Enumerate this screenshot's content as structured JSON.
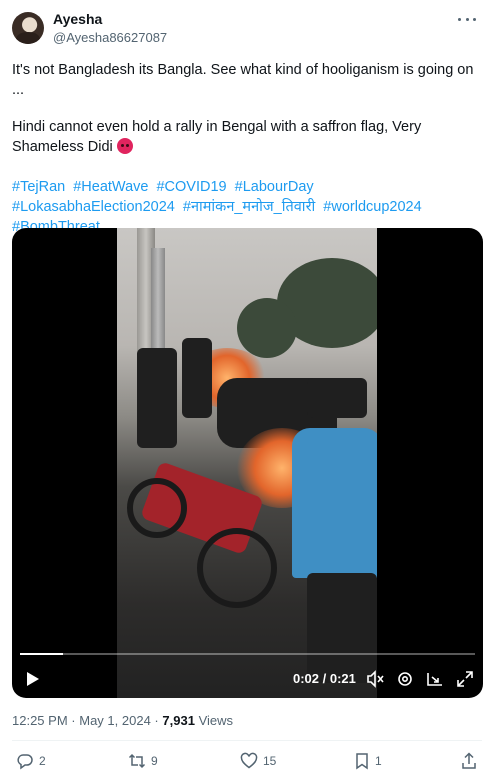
{
  "author": {
    "name": "Ayesha",
    "handle": "@Ayesha86627087"
  },
  "post": {
    "line1": "It's not Bangladesh its Bangla. See what kind of hooliganism is going on ...",
    "line2": "Hindi cannot even hold a rally in Bengal with a saffron flag, Very Shameless Didi",
    "emoji_icon": "angry-face-icon",
    "hashtags": [
      "#TejRan",
      "#HeatWave",
      "#COVID19",
      "#LabourDay",
      "#LokasabhaElection2024",
      "#नामांकन_मनोज_तिवारी",
      "#worldcup2024",
      "#BombThreat"
    ]
  },
  "video": {
    "time": "0:02 / 0:21",
    "progress": 0.095,
    "controls": [
      "play-icon",
      "mute-icon",
      "settings-icon",
      "pip-icon",
      "fullscreen-icon"
    ]
  },
  "meta": {
    "time": "12:25 PM",
    "sep1": "·",
    "date": "May 1, 2024",
    "sep2": "·",
    "views_count": "7,931",
    "views_label": "Views"
  },
  "actions": {
    "replies": "2",
    "reposts": "9",
    "likes": "15",
    "bookmarks": "1"
  },
  "colors": {
    "link": "#1d9bf0",
    "secondary_text": "#536471"
  }
}
